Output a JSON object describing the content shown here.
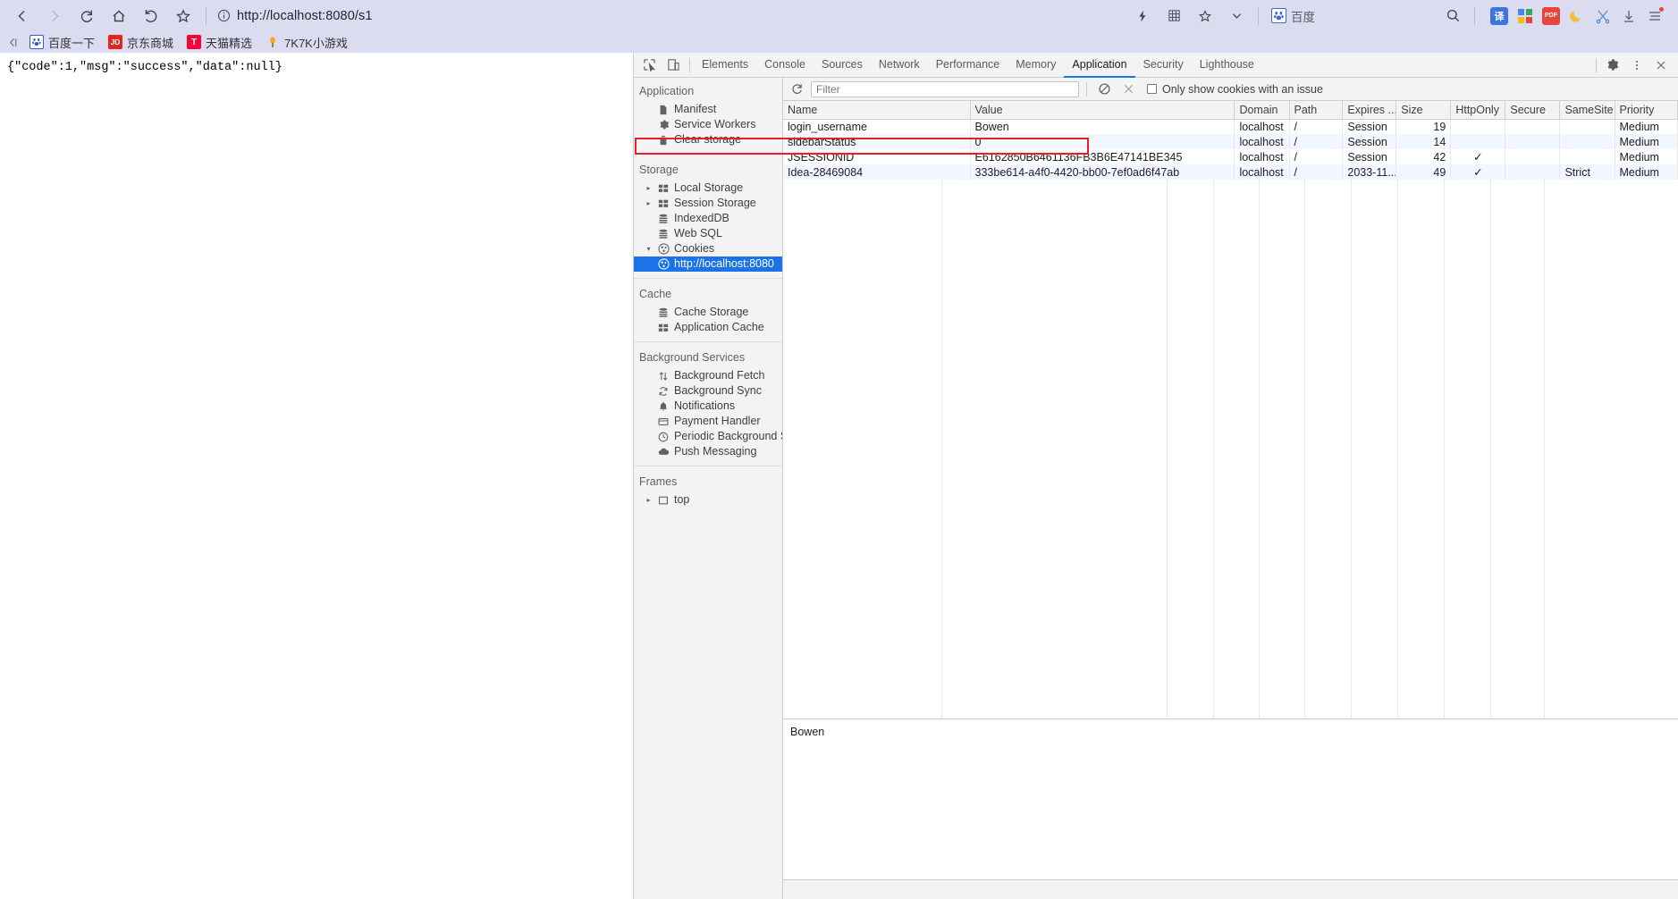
{
  "browser": {
    "nav": {
      "back": "back-arrow",
      "forward": "forward-arrow",
      "reload": "reload",
      "home": "home",
      "undo": "undo-arrow",
      "bookmark": "star"
    },
    "url": "http://localhost:8080/s1",
    "security_icon": "info-circle",
    "toolbar_right": {
      "lightning": "lightning-icon",
      "grid": "grid-icon",
      "star": "star-icon",
      "chevron": "chevron-down-icon",
      "engine_label": "百度",
      "search": "search-icon",
      "extensions": [
        {
          "name": "translate-extension",
          "label": "译",
          "color": "#3b76e0"
        },
        {
          "name": "apps-extension",
          "label": "",
          "color": "#4285f4"
        },
        {
          "name": "pdf-extension",
          "label": "PDF",
          "color": "#e8453c"
        },
        {
          "name": "night-mode-extension",
          "label": "",
          "color": "#f6bd3b"
        },
        {
          "name": "screenshot-extension",
          "label": "",
          "color": "#4a90d9"
        },
        {
          "name": "download-extension",
          "label": "",
          "color": "#5f6368"
        },
        {
          "name": "menu-extension",
          "label": "",
          "color": "#5f6368"
        }
      ]
    },
    "bookmarks": [
      {
        "label": "百度一下",
        "icon": "baidu-paw-icon",
        "color": "#2c5fd0",
        "glyph": "●"
      },
      {
        "label": "京东商城",
        "icon": "jd-icon",
        "color": "#e1251b",
        "glyph": "JD"
      },
      {
        "label": "天猫精选",
        "icon": "tmall-icon",
        "color": "#ff0036",
        "glyph": "T"
      },
      {
        "label": "7K7K小游戏",
        "icon": "7k7k-icon",
        "color": "#f5a623",
        "glyph": "●"
      }
    ]
  },
  "page": {
    "response_body": "{\"code\":1,\"msg\":\"success\",\"data\":null}"
  },
  "devtools": {
    "inspect_icon": "inspect-element-icon",
    "device_icon": "toggle-device-toolbar-icon",
    "tabs": [
      {
        "label": "Elements",
        "active": false
      },
      {
        "label": "Console",
        "active": false
      },
      {
        "label": "Sources",
        "active": false
      },
      {
        "label": "Network",
        "active": false
      },
      {
        "label": "Performance",
        "active": false
      },
      {
        "label": "Memory",
        "active": false
      },
      {
        "label": "Application",
        "active": true
      },
      {
        "label": "Security",
        "active": false
      },
      {
        "label": "Lighthouse",
        "active": false
      }
    ],
    "right_controls": {
      "settings": "gear-icon",
      "more": "more-vertical-icon",
      "close": "close-icon"
    },
    "sidebar": [
      {
        "title": "Application",
        "items": [
          {
            "label": "Manifest",
            "icon": "document-icon",
            "caret": "",
            "indent": 1,
            "selected": false
          },
          {
            "label": "Service Workers",
            "icon": "gear-icon",
            "caret": "",
            "indent": 1,
            "selected": false
          },
          {
            "label": "Clear storage",
            "icon": "trash-icon",
            "caret": "",
            "indent": 1,
            "selected": false
          }
        ]
      },
      {
        "title": "Storage",
        "items": [
          {
            "label": "Local Storage",
            "icon": "table-icon",
            "caret": "▸",
            "indent": 1,
            "selected": false
          },
          {
            "label": "Session Storage",
            "icon": "table-icon",
            "caret": "▸",
            "indent": 1,
            "selected": false
          },
          {
            "label": "IndexedDB",
            "icon": "database-icon",
            "caret": "",
            "indent": 1,
            "selected": false
          },
          {
            "label": "Web SQL",
            "icon": "database-icon",
            "caret": "",
            "indent": 1,
            "selected": false
          },
          {
            "label": "Cookies",
            "icon": "cookie-icon",
            "caret": "▾",
            "indent": 1,
            "selected": false
          },
          {
            "label": "http://localhost:8080",
            "icon": "cookie-icon",
            "caret": "",
            "indent": 2,
            "selected": true
          }
        ]
      },
      {
        "title": "Cache",
        "items": [
          {
            "label": "Cache Storage",
            "icon": "database-icon",
            "caret": "",
            "indent": 1,
            "selected": false
          },
          {
            "label": "Application Cache",
            "icon": "table-icon",
            "caret": "",
            "indent": 1,
            "selected": false
          }
        ]
      },
      {
        "title": "Background Services",
        "items": [
          {
            "label": "Background Fetch",
            "icon": "arrows-updown-icon",
            "caret": "",
            "indent": 1,
            "selected": false
          },
          {
            "label": "Background Sync",
            "icon": "sync-icon",
            "caret": "",
            "indent": 1,
            "selected": false
          },
          {
            "label": "Notifications",
            "icon": "bell-icon",
            "caret": "",
            "indent": 1,
            "selected": false
          },
          {
            "label": "Payment Handler",
            "icon": "card-icon",
            "caret": "",
            "indent": 1,
            "selected": false
          },
          {
            "label": "Periodic Background Sync",
            "icon": "clock-icon",
            "caret": "",
            "indent": 1,
            "selected": false
          },
          {
            "label": "Push Messaging",
            "icon": "cloud-icon",
            "caret": "",
            "indent": 1,
            "selected": false
          }
        ]
      },
      {
        "title": "Frames",
        "items": [
          {
            "label": "top",
            "icon": "frame-icon",
            "caret": "▸",
            "indent": 1,
            "selected": false
          }
        ]
      }
    ],
    "cookies_toolbar": {
      "refresh_icon": "refresh-icon",
      "filter_placeholder": "Filter",
      "filter_value": "",
      "clear_all_icon": "block-icon",
      "delete_icon": "close-icon",
      "issue_checkbox_label": "Only show cookies with an issue",
      "issue_checkbox_checked": false
    },
    "cookies_table": {
      "columns": [
        "Name",
        "Value",
        "Domain",
        "Path",
        "Expires ...",
        "Size",
        "HttpOnly",
        "Secure",
        "SameSite",
        "Priority"
      ],
      "rows": [
        {
          "name": "login_username",
          "value": "Bowen",
          "domain": "localhost",
          "path": "/",
          "expires": "Session",
          "size": "19",
          "httponly": "",
          "secure": "",
          "samesite": "",
          "priority": "Medium",
          "highlighted": false
        },
        {
          "name": "sidebarStatus",
          "value": "0",
          "domain": "localhost",
          "path": "/",
          "expires": "Session",
          "size": "14",
          "httponly": "",
          "secure": "",
          "samesite": "",
          "priority": "Medium",
          "highlighted": false
        },
        {
          "name": "JSESSIONID",
          "value": "E6162850B6461136FB3B6E47141BE345",
          "domain": "localhost",
          "path": "/",
          "expires": "Session",
          "size": "42",
          "httponly": "✓",
          "secure": "",
          "samesite": "",
          "priority": "Medium",
          "highlighted": true
        },
        {
          "name": "Idea-28469084",
          "value": "333be614-a4f0-4420-bb00-7ef0ad6f47ab",
          "domain": "localhost",
          "path": "/",
          "expires": "2033-11...",
          "size": "49",
          "httponly": "✓",
          "secure": "",
          "samesite": "Strict",
          "priority": "Medium",
          "highlighted": false
        }
      ]
    },
    "cookie_detail_value": "Bowen",
    "highlight_color": "#ee1c25"
  }
}
